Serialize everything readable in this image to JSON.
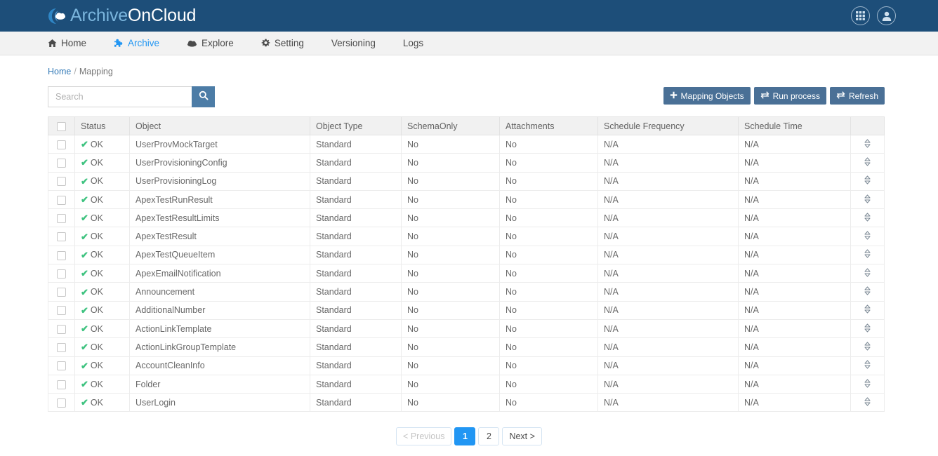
{
  "brand": {
    "name_part1": "Archive",
    "name_part2": "OnCloud",
    "logo_icon": "cloud-icon"
  },
  "topbar": {
    "apps_icon": "grid-apps-icon",
    "account_icon": "user-account-icon"
  },
  "nav": {
    "items": [
      {
        "label": "Home",
        "icon": "home-icon",
        "active": false
      },
      {
        "label": "Archive",
        "icon": "puzzle-piece-icon",
        "active": true
      },
      {
        "label": "Explore",
        "icon": "cloud-icon",
        "active": false
      },
      {
        "label": "Setting",
        "icon": "gear-icon",
        "active": false
      },
      {
        "label": "Versioning",
        "icon": "",
        "active": false
      },
      {
        "label": "Logs",
        "icon": "",
        "active": false
      }
    ]
  },
  "breadcrumb": {
    "home": "Home",
    "separator": "/",
    "current": "Mapping"
  },
  "search": {
    "placeholder": "Search",
    "value": "",
    "button_icon": "search-icon"
  },
  "toolbar": {
    "mapping_objects_label": "Mapping Objects",
    "mapping_objects_icon": "plus-icon",
    "run_process_label": "Run process",
    "run_process_icon": "exchange-arrows-icon",
    "refresh_label": "Refresh",
    "refresh_icon": "exchange-arrows-icon"
  },
  "table": {
    "headers": [
      "",
      "Status",
      "Object",
      "Object Type",
      "SchemaOnly",
      "Attachments",
      "Schedule Frequency",
      "Schedule Time",
      ""
    ],
    "select_all_icon": "checkbox-icon",
    "sort_icon": "sort-up-down-icon",
    "rows": [
      {
        "status": "OK",
        "object": "UserProvMockTarget",
        "object_type": "Standard",
        "schema_only": "No",
        "attachments": "No",
        "schedule_frequency": "N/A",
        "schedule_time": "N/A"
      },
      {
        "status": "OK",
        "object": "UserProvisioningConfig",
        "object_type": "Standard",
        "schema_only": "No",
        "attachments": "No",
        "schedule_frequency": "N/A",
        "schedule_time": "N/A"
      },
      {
        "status": "OK",
        "object": "UserProvisioningLog",
        "object_type": "Standard",
        "schema_only": "No",
        "attachments": "No",
        "schedule_frequency": "N/A",
        "schedule_time": "N/A"
      },
      {
        "status": "OK",
        "object": "ApexTestRunResult",
        "object_type": "Standard",
        "schema_only": "No",
        "attachments": "No",
        "schedule_frequency": "N/A",
        "schedule_time": "N/A"
      },
      {
        "status": "OK",
        "object": "ApexTestResultLimits",
        "object_type": "Standard",
        "schema_only": "No",
        "attachments": "No",
        "schedule_frequency": "N/A",
        "schedule_time": "N/A"
      },
      {
        "status": "OK",
        "object": "ApexTestResult",
        "object_type": "Standard",
        "schema_only": "No",
        "attachments": "No",
        "schedule_frequency": "N/A",
        "schedule_time": "N/A"
      },
      {
        "status": "OK",
        "object": "ApexTestQueueItem",
        "object_type": "Standard",
        "schema_only": "No",
        "attachments": "No",
        "schedule_frequency": "N/A",
        "schedule_time": "N/A"
      },
      {
        "status": "OK",
        "object": "ApexEmailNotification",
        "object_type": "Standard",
        "schema_only": "No",
        "attachments": "No",
        "schedule_frequency": "N/A",
        "schedule_time": "N/A"
      },
      {
        "status": "OK",
        "object": "Announcement",
        "object_type": "Standard",
        "schema_only": "No",
        "attachments": "No",
        "schedule_frequency": "N/A",
        "schedule_time": "N/A"
      },
      {
        "status": "OK",
        "object": "AdditionalNumber",
        "object_type": "Standard",
        "schema_only": "No",
        "attachments": "No",
        "schedule_frequency": "N/A",
        "schedule_time": "N/A"
      },
      {
        "status": "OK",
        "object": "ActionLinkTemplate",
        "object_type": "Standard",
        "schema_only": "No",
        "attachments": "No",
        "schedule_frequency": "N/A",
        "schedule_time": "N/A"
      },
      {
        "status": "OK",
        "object": "ActionLinkGroupTemplate",
        "object_type": "Standard",
        "schema_only": "No",
        "attachments": "No",
        "schedule_frequency": "N/A",
        "schedule_time": "N/A"
      },
      {
        "status": "OK",
        "object": "AccountCleanInfo",
        "object_type": "Standard",
        "schema_only": "No",
        "attachments": "No",
        "schedule_frequency": "N/A",
        "schedule_time": "N/A"
      },
      {
        "status": "OK",
        "object": "Folder",
        "object_type": "Standard",
        "schema_only": "No",
        "attachments": "No",
        "schedule_frequency": "N/A",
        "schedule_time": "N/A"
      },
      {
        "status": "OK",
        "object": "UserLogin",
        "object_type": "Standard",
        "schema_only": "No",
        "attachments": "No",
        "schedule_frequency": "N/A",
        "schedule_time": "N/A"
      }
    ]
  },
  "pagination": {
    "previous_label": "<  Previous",
    "next_label": "Next  >",
    "pages": [
      "1",
      "2"
    ],
    "active_page": "1"
  },
  "colors": {
    "header_navy": "#1d4e79",
    "accent_blue": "#2196f3",
    "button_steel": "#4a7096",
    "search_button": "#4c7ca6",
    "status_green": "#3fc380",
    "link_blue": "#337ab7"
  }
}
